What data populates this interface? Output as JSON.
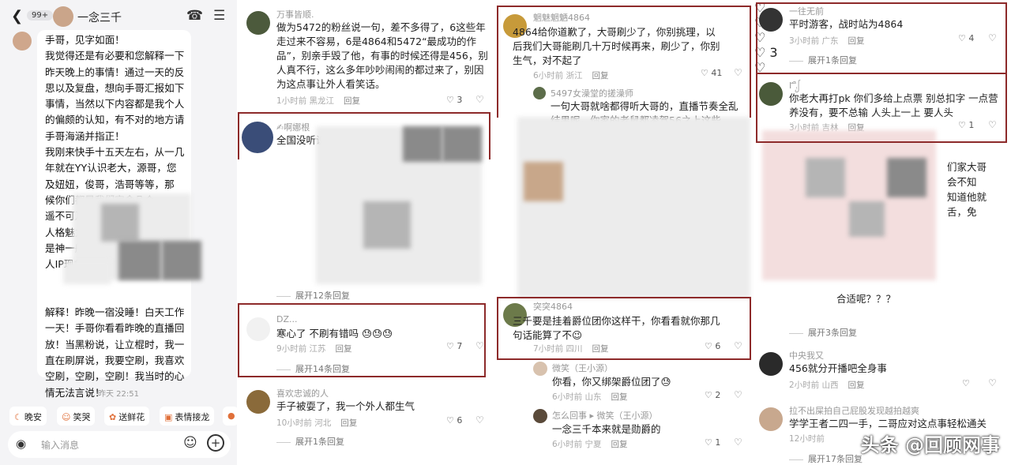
{
  "chat": {
    "badge": "99+",
    "title": "一念三千",
    "back_icon": "chevron-left-icon",
    "message_lines": [
      "手哥，见字如面！",
      "我觉得还是有必要和您解释一下",
      "昨天晚上的事情！通过一天的反",
      "思以及复盘，想向手哥汇报如下",
      "事情，当然以下内容都是我个人",
      "的偏颇的认知，有不对的地方请",
      "手哥海涵并指正！",
      "我刚来快手十五天左右，从一几",
      "年就在YY认识老大，源哥，您",
      "及妞妞，俊哥，浩哥等等，那",
      "候你们都是我们宿舍几个",
      "遥不可及的偶",
      "人格魅力",
      "是神一般",
      "人IP现象",
      "",
      "",
      "解释！昨晚一宿没睡！白天工作",
      "一天！手哥你看看昨晚的直播回",
      "放！当黑粉说，让立棍时，我一",
      "直在刷屏说，我要空刷，我喜欢",
      "空刷，空刷，空刷！我当时的心",
      "情无法言说！"
    ],
    "timestamp": "昨天 22:51",
    "quick_replies": [
      "晚安",
      "笑哭",
      "送鲜花",
      "表情接龙"
    ],
    "input_placeholder": "输入消息"
  },
  "col2": {
    "comments": [
      {
        "name": "万事皆顺.",
        "lines": [
          "做为5472的粉丝说一句，差不多得了，6这些年",
          "走过来不容易，6是4864和5472“最成功的作",
          "品”，别亲手毁了他，有事的时候还得是456，别",
          "人真不行，这么多年吵吵闹闹的都过来了，别因",
          "为这点事让外人看笑话。"
        ],
        "time": "1小时前",
        "location": "黑龙江",
        "reply": "回复",
        "likes": "3"
      },
      {
        "name": "✍啊娜根",
        "lines": [
          "全国没听说过"
        ],
        "time": "",
        "location": "",
        "reply": "",
        "likes": "26"
      },
      {
        "name": "DZ...",
        "lines": [
          "寒心了  不刷有错吗 😓😓😓"
        ],
        "time": "9小时前",
        "location": "江苏",
        "reply": "回复",
        "likes": "7"
      },
      {
        "name": "喜欢忠诚的人",
        "lines": [
          "手子被耍了，我一个外人都生气"
        ],
        "time": "10小时前",
        "location": "河北",
        "reply": "回复",
        "likes": "6"
      }
    ],
    "expand": [
      "展开12条回复",
      "展开14条回复",
      "展开1条回复"
    ]
  },
  "col3": {
    "comments": [
      {
        "name": "魍魅魍魉4864",
        "lines": [
          "4864给你道歉了，大哥刷少了，你别挑理，以",
          "后我们大哥能刷几十万时候再来，刷少了，你别",
          "生气，对不起了"
        ],
        "time": "6小时前",
        "location": "浙江",
        "reply": "回复",
        "likes": "41"
      },
      {
        "name": "5497女澡堂的搓澡师",
        "lines": [
          "一句大哥就啥都得听大哥的，直播节奏全乱",
          "结果呢，你家的老鼠都凌驾56之上这些"
        ],
        "time": "",
        "location": "",
        "reply": "",
        "likes": ""
      },
      {
        "name": "突突4864",
        "lines": [
          "三千要是挂着爵位团你这样干，你看看就你那几",
          "句话能算了不😉"
        ],
        "time": "7小时前",
        "location": "四川",
        "reply": "回复",
        "likes": "6"
      },
      {
        "name": "微笑（王小源）",
        "lines": [
          "你看，你又绑架爵位团了😓"
        ],
        "time": "6小时前",
        "location": "山东",
        "reply": "回复",
        "likes": "2"
      },
      {
        "name": "怎么回事 ▸ 微笑（王小源）",
        "lines": [
          "一念三千本来就是勋爵的"
        ],
        "time": "6小时前",
        "location": "宁夏",
        "reply": "回复",
        "likes": "1"
      }
    ]
  },
  "col4": {
    "comments": [
      {
        "name": "一往无前",
        "lines": [
          "平时游客，战时站为4864"
        ],
        "time": "3小时前",
        "location": "广东",
        "reply": "回复",
        "likes": "4"
      },
      {
        "name": "Iࢭ࢑ᩭ",
        "lines": [
          "你老大再打pk 你们多给上点票 别总扣字 一点营",
          "养没有，要不总输 人头上一上  要人头"
        ],
        "time": "3小时前",
        "location": "吉林",
        "reply": "回复",
        "likes": "1"
      },
      {
        "name": "中央我又",
        "lines": [
          "456就分开播吧全身事"
        ],
        "time": "2小时前",
        "location": "山西",
        "reply": "回复",
        "likes": ""
      },
      {
        "name": "拉不出屎拍自己屁股发现越拍越爽",
        "lines": [
          "学学王者二四一手，二哥应对这点事轻松通关"
        ],
        "time": "12小时前",
        "location": "",
        "reply": "",
        "likes": ""
      }
    ],
    "partial_lines": [
      "们家大哥",
      "会不知",
      "知道他就",
      "舌，免",
      "合适呢？？？"
    ],
    "expand": [
      "展开1条回复",
      "展开3条回复",
      "展开17条回复"
    ]
  },
  "watermark": "头条 @回顾网事"
}
